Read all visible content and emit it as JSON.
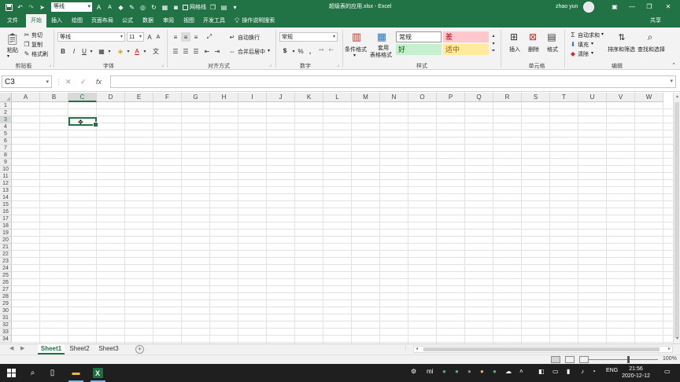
{
  "titlebar": {
    "font_name": "等线",
    "gridlines_label": "网格线",
    "window_title": "超级表的应用.xlsx - Excel",
    "user_name": "zhao yun",
    "icons": [
      "save-icon",
      "undo-icon",
      "redo-icon",
      "send-icon",
      "font-grow-icon",
      "font-shrink-icon",
      "eraser-icon",
      "brush-icon",
      "shapes-icon",
      "camera-icon"
    ]
  },
  "tabs": [
    "文件",
    "开始",
    "插入",
    "绘图",
    "页面布局",
    "公式",
    "数据",
    "审阅",
    "视图",
    "开发工具"
  ],
  "active_tab": "开始",
  "tell_me": "操作说明搜索",
  "share": "共享",
  "ribbon": {
    "clipboard": {
      "label": "剪贴板",
      "paste": "粘贴",
      "cut": "剪切",
      "copy": "复制",
      "format_painter": "格式刷"
    },
    "font": {
      "label": "字体",
      "font_name": "等线",
      "font_size": "11",
      "bold": "B",
      "italic": "I",
      "underline": "U"
    },
    "alignment": {
      "label": "对齐方式",
      "wrap_text": "自动换行",
      "merge_center": "合并后居中"
    },
    "number": {
      "label": "数字",
      "format": "常规",
      "percent": "%",
      "comma": ","
    },
    "styles": {
      "label": "样式",
      "conditional": "条件格式",
      "format_table_1": "套用",
      "format_table_2": "表格格式",
      "normal": "常规",
      "bad": "差",
      "good": "好",
      "neutral": "适中"
    },
    "cells": {
      "label": "单元格",
      "insert": "插入",
      "delete": "删除",
      "format": "格式"
    },
    "editing": {
      "label": "编辑",
      "autosum": "自动求和",
      "fill": "填充",
      "clear": "清除",
      "sort_filter": "排序和筛选",
      "find_select": "查找和选择"
    }
  },
  "formula_bar": {
    "name_box": "C3",
    "cancel": "✕",
    "enter": "✓",
    "fx": "fx",
    "value": ""
  },
  "columns": [
    "A",
    "B",
    "C",
    "D",
    "E",
    "F",
    "G",
    "H",
    "I",
    "J",
    "K",
    "L",
    "M",
    "N",
    "O",
    "P",
    "Q",
    "R",
    "S",
    "T",
    "U",
    "V",
    "W"
  ],
  "rows": [
    "1",
    "2",
    "3",
    "4",
    "5",
    "6",
    "7",
    "8",
    "9",
    "10",
    "11",
    "12",
    "13",
    "14",
    "15",
    "16",
    "17",
    "18",
    "19",
    "20",
    "21",
    "22",
    "23",
    "24",
    "25",
    "26",
    "27",
    "28",
    "29",
    "30",
    "31",
    "32",
    "33",
    "34"
  ],
  "selected": {
    "column": "C",
    "row": "3"
  },
  "sheets": [
    "Sheet1",
    "Sheet2",
    "Sheet3"
  ],
  "active_sheet": "Sheet1",
  "status": {
    "zoom": "100%"
  },
  "taskbar": {
    "lang": "ENG",
    "time": "21:56",
    "date": "2020-12-12"
  },
  "colors": {
    "excel_green": "#217346",
    "bad_fill": "#ffc7ce",
    "bad_text": "#9c0006",
    "good_fill": "#c6efce",
    "good_text": "#006100",
    "neutral_fill": "#ffeb9c",
    "neutral_text": "#9c5700"
  }
}
